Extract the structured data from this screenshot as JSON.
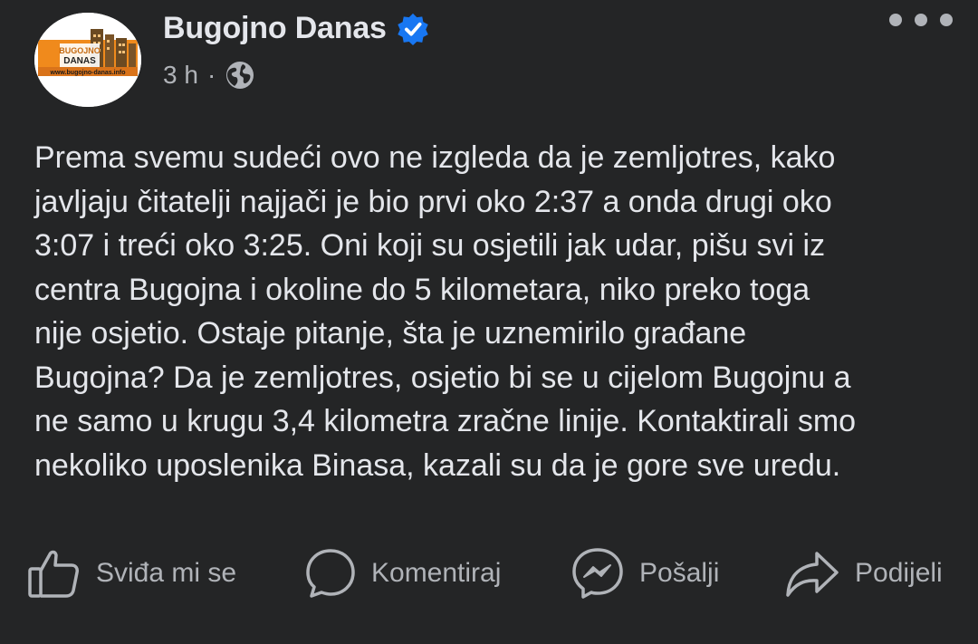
{
  "post": {
    "author_name": "Bugojno Danas",
    "timestamp": "3 h",
    "separator": "·",
    "avatar": {
      "logo_text_top": "BUGOJNO",
      "logo_text_bottom": "DANAS",
      "logo_url_text": "www.bugojno-danas.info"
    },
    "verified_icon": "verified-badge-icon",
    "privacy_icon": "globe-icon",
    "body": "Prema svemu sudeći ovo ne izgleda da je zemljotres, kako\njavljaju čitatelji najjači je bio prvi oko 2:37 a onda drugi oko\n3:07 i treći oko 3:25. Oni koji su osjetili jak udar, pišu svi iz\ncentra Bugojna i okoline do 5 kilometara, niko preko toga\nnije osjetio. Ostaje pitanje, šta je uznemirilo građane\nBugojna? Da je zemljotres, osjetio bi se u cijelom Bugojnu a\nne samo u krugu 3,4 kilometra zračne linije. Kontaktirali smo\nnekoliko uposlenika Binasa, kazali su da je gore sve uredu."
  },
  "actions": {
    "like_label": "Sviđa mi se",
    "comment_label": "Komentiraj",
    "send_label": "Pošalji",
    "share_label": "Podijeli"
  },
  "colors": {
    "background": "#242526",
    "primary_text": "#e4e6eb",
    "secondary_text": "#b0b3b8",
    "verified_blue": "#1877f2",
    "logo_orange": "#f08a1c"
  }
}
